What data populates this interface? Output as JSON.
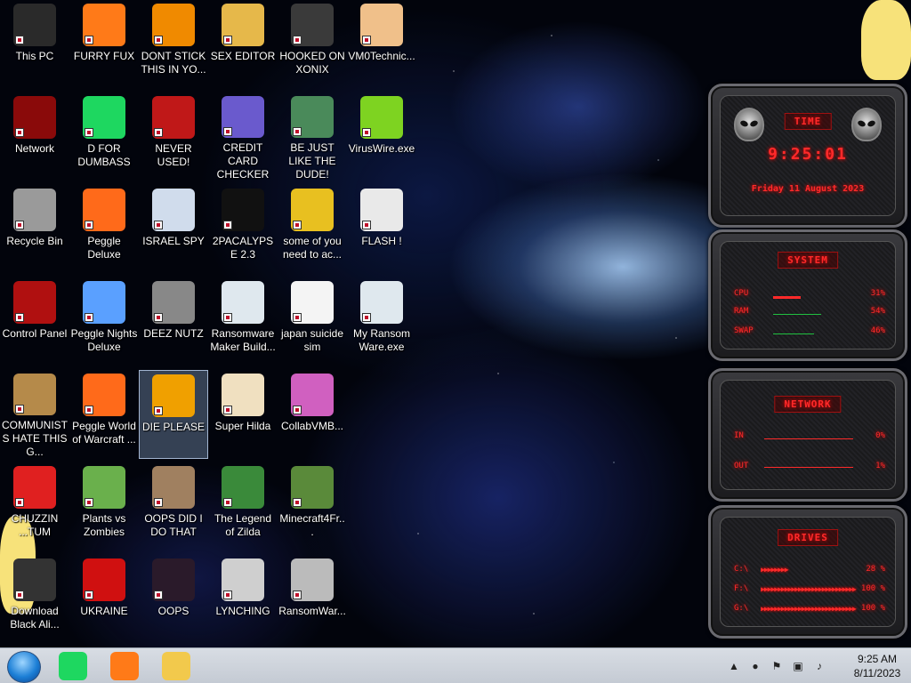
{
  "desktop": {
    "icons": [
      {
        "label": "This PC",
        "icon": "this-pc-icon",
        "color": "#2a2a2a"
      },
      {
        "label": "FURRY FUX",
        "icon": "firefox-icon",
        "color": "#ff7a18"
      },
      {
        "label": "DONT STICK THIS IN YO...",
        "icon": "vlc-cone-icon",
        "color": "#f08a00"
      },
      {
        "label": "SEX EDITOR",
        "icon": "hxd-editor-icon",
        "color": "#e6b84a"
      },
      {
        "label": "HOOKED ON XONIX",
        "icon": "xonix-game-icon",
        "color": "#3a3a3a"
      },
      {
        "label": "VM0Technic...",
        "icon": "doctor-icon",
        "color": "#f0c08a"
      },
      {
        "label": "Network",
        "icon": "network-icon",
        "color": "#8a0a0a"
      },
      {
        "label": "D FOR DUMBASS",
        "icon": "discord-icon",
        "color": "#1ed760"
      },
      {
        "label": "NEVER USED!",
        "icon": "devcpp-icon",
        "color": "#c01818"
      },
      {
        "label": "CREDIT CARD CHECKER",
        "icon": "credit-card-icon",
        "color": "#6a5acd"
      },
      {
        "label": "BE JUST LIKE THE DUDE!",
        "icon": "dude-icon",
        "color": "#4a8a5a"
      },
      {
        "label": "VirusWire.exe",
        "icon": "limewire-icon",
        "color": "#7ed321"
      },
      {
        "label": "Recycle Bin",
        "icon": "recycle-bin-icon",
        "color": "#9a9a9a"
      },
      {
        "label": "Peggle Deluxe",
        "icon": "peggle-icon",
        "color": "#ff6a1a"
      },
      {
        "label": "ISRAEL SPY",
        "icon": "spy-network-icon",
        "color": "#d0dcec"
      },
      {
        "label": "2PACALYPSE 2.3",
        "icon": "terminal-icon",
        "color": "#111111"
      },
      {
        "label": "some of you need to ac...",
        "icon": "dog-icon",
        "color": "#e8c020"
      },
      {
        "label": "FLASH !",
        "icon": "flash-player-icon",
        "color": "#e9e9e9"
      },
      {
        "label": "Control Panel",
        "icon": "control-panel-icon",
        "color": "#b01010"
      },
      {
        "label": "Peggle Nights Deluxe",
        "icon": "peggle-nights-icon",
        "color": "#5aa0ff"
      },
      {
        "label": "DEEZ NUTZ",
        "icon": "window-stack-icon",
        "color": "#888888"
      },
      {
        "label": "Ransomware Maker Build...",
        "icon": "app-window-icon",
        "color": "#dfe8ee"
      },
      {
        "label": "japan suicide sim",
        "icon": "document-icon",
        "color": "#f4f4f4"
      },
      {
        "label": "My Ransom Ware.exe",
        "icon": "app-window-icon",
        "color": "#dfe8ee"
      },
      {
        "label": "COMMUNISTS HATE THIS G...",
        "icon": "money-bag-icon",
        "color": "#b58a4a"
      },
      {
        "label": "Peggle World of Warcraft ...",
        "icon": "peggle-wow-icon",
        "color": "#ff6a1a"
      },
      {
        "label": "DIE PLEASE",
        "icon": "de-logo-icon",
        "color": "#f0a000"
      },
      {
        "label": "Super Hilda",
        "icon": "pixel-character-icon",
        "color": "#f0e0c0"
      },
      {
        "label": "CollabVMB...",
        "icon": "collab-monitor-icon",
        "color": "#d060c0"
      },
      {
        "label": "",
        "icon": "",
        "color": ""
      },
      {
        "label": "CHUZZIN ...TUM",
        "icon": "chuzzle-icon",
        "color": "#e02020"
      },
      {
        "label": "Plants vs Zombies",
        "icon": "pvz-icon",
        "color": "#6ab04c"
      },
      {
        "label": "OOPS DID I DO THAT",
        "icon": "portrait-icon",
        "color": "#a08060"
      },
      {
        "label": "The Legend of Zilda",
        "icon": "pixel-hero-icon",
        "color": "#3a8a3a"
      },
      {
        "label": "Minecraft4Fr...",
        "icon": "minecraft-block-icon",
        "color": "#5a8a3a"
      },
      {
        "label": "",
        "icon": "",
        "color": ""
      },
      {
        "label": "Download Black Ali...",
        "icon": "download-icon",
        "color": "#333333"
      },
      {
        "label": "UKRAINE",
        "icon": "radiation-icon",
        "color": "#d01010"
      },
      {
        "label": "OOPS",
        "icon": "dark-app-icon",
        "color": "#2a1a2a"
      },
      {
        "label": "LYNCHING",
        "icon": "noose-icon",
        "color": "#cfcfcf"
      },
      {
        "label": "RansomWar...",
        "icon": "skull-icon",
        "color": "#bbbbbb"
      },
      {
        "label": "",
        "icon": "",
        "color": ""
      }
    ],
    "selected_index": 26
  },
  "widgets": {
    "time": {
      "title": "TIME",
      "time": "9:25:01",
      "date": "Friday 11 August 2023"
    },
    "system": {
      "title": "SYSTEM",
      "rows": [
        {
          "label": "CPU",
          "value": "31%",
          "fill": 0.31
        },
        {
          "label": "RAM",
          "value": "54%",
          "fill": 0.54
        },
        {
          "label": "SWAP",
          "value": "46%",
          "fill": 0.46
        }
      ]
    },
    "network": {
      "title": "NETWORK",
      "rows": [
        {
          "label": "IN",
          "value": "0%"
        },
        {
          "label": "OUT",
          "value": "1%"
        }
      ]
    },
    "drives": {
      "title": "DRIVES",
      "rows": [
        {
          "label": "C:\\",
          "value": "28 %",
          "fill": 0.28
        },
        {
          "label": "F:\\",
          "value": "100 %",
          "fill": 1.0
        },
        {
          "label": "G:\\",
          "value": "100 %",
          "fill": 1.0
        }
      ]
    },
    "accent_color": "#ff2a2a"
  },
  "taskbar": {
    "start": "windows-orb-icon",
    "pinned": [
      {
        "name": "discord-taskbar-icon",
        "color": "#1ed760"
      },
      {
        "name": "firefox-taskbar-icon",
        "color": "#ff7a18"
      },
      {
        "name": "file-explorer-taskbar-icon",
        "color": "#f2c94c"
      }
    ],
    "tray": [
      "chevron-up-icon",
      "network-globe-icon",
      "flag-icon",
      "network-icon",
      "volume-icon"
    ],
    "clock": {
      "time": "9:25 AM",
      "date": "8/11/2023"
    }
  }
}
